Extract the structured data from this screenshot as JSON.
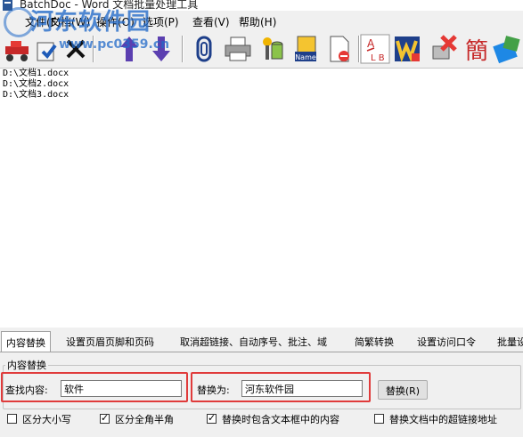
{
  "window": {
    "title": "BatchDoc - Word 文档批量处理工具"
  },
  "watermark": {
    "logo": "河东软件园",
    "url": "www.pc0359.cn"
  },
  "menu": [
    {
      "label": "文件(F)"
    },
    {
      "label": "文档(W)"
    },
    {
      "label": "操作(O)"
    },
    {
      "label": "选项(P)"
    },
    {
      "label": "查看(V)"
    },
    {
      "label": "帮助(H)"
    }
  ],
  "toolbar": [
    {
      "icon": "run-icon"
    },
    {
      "icon": "add-file-icon"
    },
    {
      "icon": "remove-icon"
    },
    {
      "icon": "move-up-icon"
    },
    {
      "icon": "move-down-icon"
    },
    {
      "icon": "clip-icon"
    },
    {
      "icon": "printer-icon"
    },
    {
      "icon": "database-icon"
    },
    {
      "icon": "rename-icon"
    },
    {
      "icon": "delete-doc-icon"
    },
    {
      "icon": "replace-text-icon"
    },
    {
      "icon": "word-icon"
    },
    {
      "icon": "clear-icon"
    },
    {
      "icon": "traditional-icon"
    },
    {
      "icon": "tools-icon"
    }
  ],
  "toolbar_glyphs": {
    "rename": "Name",
    "traditional": "簡",
    "replace_a": "A",
    "replace_b": "L B"
  },
  "files": [
    "D:\\文档1.docx",
    "D:\\文档2.docx",
    "D:\\文档3.docx"
  ],
  "tabs": [
    {
      "label": "内容替换",
      "active": true
    },
    {
      "label": "设置页眉页脚和页码"
    },
    {
      "label": "取消超链接、自动序号、批注、域"
    },
    {
      "label": "简繁转换"
    },
    {
      "label": "设置访问口令"
    },
    {
      "label": "批量设"
    }
  ],
  "replace_panel": {
    "group_title": "内容替换",
    "find_label": "查找内容:",
    "find_value": "软件",
    "replace_label": "替换为:",
    "replace_value": "河东软件园",
    "replace_button": "替换(R)",
    "options": [
      {
        "label": "区分大小写",
        "checked": false
      },
      {
        "label": "区分全角半角",
        "checked": true
      },
      {
        "label": "替换时包含文本框中的内容",
        "checked": true
      },
      {
        "label": "替换文档中的超链接地址",
        "checked": false
      }
    ]
  },
  "colors": {
    "highlight": "#e03b3b",
    "watermark": "#2169c8",
    "list_bg": "#ffffff"
  }
}
